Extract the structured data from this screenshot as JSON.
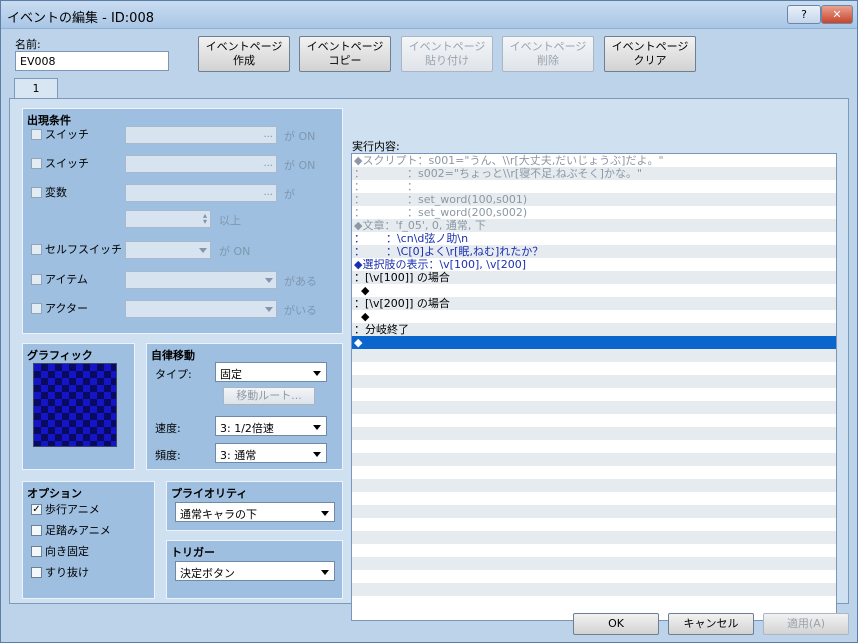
{
  "window": {
    "title": "イベントの編集 - ID:008",
    "help_glyph": "?",
    "close_glyph": "✕"
  },
  "name": {
    "label": "名前:",
    "value": "EV008"
  },
  "page_toolbar": [
    {
      "line1": "イベントページ",
      "line2": "作成",
      "enabled": true
    },
    {
      "line1": "イベントページ",
      "line2": "コピー",
      "enabled": true
    },
    {
      "line1": "イベントページ",
      "line2": "貼り付け",
      "enabled": false
    },
    {
      "line1": "イベントページ",
      "line2": "削除",
      "enabled": false
    },
    {
      "line1": "イベントページ",
      "line2": "クリア",
      "enabled": true
    }
  ],
  "tab": {
    "label": "1"
  },
  "conditions": {
    "title": "出現条件",
    "switch1": {
      "label": "スイッチ",
      "suffix": "が ON",
      "dots": "..."
    },
    "switch2": {
      "label": "スイッチ",
      "suffix": "が ON",
      "dots": "..."
    },
    "variable": {
      "label": "変数",
      "suffix": "が",
      "dots": "...",
      "suffix2": "以上"
    },
    "self_switch": {
      "label": "セルフスイッチ",
      "suffix": "が ON"
    },
    "item": {
      "label": "アイテム",
      "suffix": "がある"
    },
    "actor": {
      "label": "アクター",
      "suffix": "がいる"
    }
  },
  "graphic": {
    "title": "グラフィック"
  },
  "autonomous": {
    "title": "自律移動",
    "type_label": "タイプ:",
    "type_value": "固定",
    "route_button": "移動ルート...",
    "speed_label": "速度:",
    "speed_value": "3: 1/2倍速",
    "freq_label": "頻度:",
    "freq_value": "3: 通常"
  },
  "options": {
    "title": "オプション",
    "walk": {
      "label": "歩行アニメ",
      "checked": true
    },
    "step": {
      "label": "足踏みアニメ",
      "checked": false
    },
    "dirfix": {
      "label": "向き固定",
      "checked": false
    },
    "through": {
      "label": "すり抜け",
      "checked": false
    },
    "check_glyph": "✓"
  },
  "priority": {
    "title": "プライオリティ",
    "value": "通常キャラの下"
  },
  "trigger": {
    "title": "トリガー",
    "value": "決定ボタン"
  },
  "commands": {
    "label": "実行内容:",
    "rows": [
      {
        "text": "◆スクリプト：s001=\"うん、\\\\r[大丈夫,だいじょうぶ]だよ。\"",
        "style": "gray"
      },
      {
        "text": "：            ：s002=\"ちょっと\\\\r[寝不足,ねぶそく]かな。\"",
        "style": "gray"
      },
      {
        "text": "：            ：",
        "style": "gray"
      },
      {
        "text": "：            ：set_word(100,s001)",
        "style": "gray"
      },
      {
        "text": "：            ：set_word(200,s002)",
        "style": "gray"
      },
      {
        "text": "◆文章：'f_05', 0, 通常, 下",
        "style": "gray"
      },
      {
        "text": "：      ：\\cn\\d弦ノ助\\n",
        "style": "blue"
      },
      {
        "text": "：      ：\\C[0]よく\\r[眠,ねむ]れたか？",
        "style": "blue"
      },
      {
        "text": "◆選択肢の表示：\\v[100], \\v[200]",
        "style": "blue"
      },
      {
        "text": "：[\\v[100]] の場合",
        "style": "black"
      },
      {
        "text": "  ◆",
        "style": "black"
      },
      {
        "text": "：[\\v[200]] の場合",
        "style": "black"
      },
      {
        "text": "  ◆",
        "style": "black"
      },
      {
        "text": "：分岐終了",
        "style": "black"
      },
      {
        "text": "◆",
        "style": "selected"
      }
    ]
  },
  "footer": {
    "ok": "OK",
    "cancel": "キャンセル",
    "apply": "適用(A)"
  }
}
